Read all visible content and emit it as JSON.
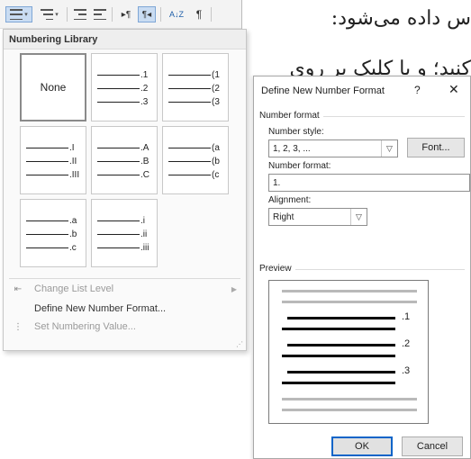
{
  "document": {
    "line1": "س داده می‌شود:",
    "line2": "کنید؛ و با کلیک بر روی"
  },
  "toolbar": {
    "sort_label": "A↓Z",
    "pilcrow": "¶",
    "ltr_label": "▸¶",
    "rtl_label": "¶◂"
  },
  "numbering_library": {
    "header": "Numbering Library",
    "tiles": [
      {
        "kind": "none",
        "label": "None"
      },
      {
        "kind": "list",
        "labels": [
          "1.",
          "2.",
          "3."
        ]
      },
      {
        "kind": "list",
        "labels": [
          "(1",
          "(2",
          "(3"
        ]
      },
      {
        "kind": "list",
        "labels": [
          "I.",
          "II.",
          "III."
        ]
      },
      {
        "kind": "list",
        "labels": [
          "A.",
          "B.",
          "C."
        ]
      },
      {
        "kind": "list",
        "labels": [
          "(a",
          "(b",
          "(c"
        ]
      },
      {
        "kind": "list",
        "labels": [
          "a.",
          "b.",
          "c."
        ]
      },
      {
        "kind": "list",
        "labels": [
          "i.",
          "ii.",
          "iii."
        ]
      }
    ],
    "tile_labels": [
      [
        "",
        "",
        ""
      ],
      [
        ".1",
        ".2",
        ".3"
      ],
      [
        "(1",
        "(2",
        "(3"
      ],
      [
        ".I",
        ".II",
        ".III"
      ],
      [
        ".A",
        ".B",
        ".C"
      ],
      [
        "(a",
        "(b",
        "(c"
      ],
      [
        ".a",
        ".b",
        ".c"
      ],
      [
        ".i",
        ".ii",
        ".iii"
      ]
    ],
    "menu": {
      "change_list_level": "Change List Level",
      "define_new_format": "Define New Number Format...",
      "set_numbering_value": "Set Numbering Value..."
    }
  },
  "dialog": {
    "title": "Define New Number Format",
    "help": "?",
    "close": "✕",
    "number_format_group": "Number format",
    "number_style_label": "Number style:",
    "number_style_value": "1, 2, 3, ...",
    "font_button": "Font...",
    "number_format_label": "Number format:",
    "number_format_value": "1.",
    "alignment_label": "Alignment:",
    "alignment_value": "Right",
    "preview_group": "Preview",
    "preview_numbers": [
      ".1",
      ".2",
      ".3"
    ],
    "ok_button": "OK",
    "cancel_button": "Cancel"
  }
}
